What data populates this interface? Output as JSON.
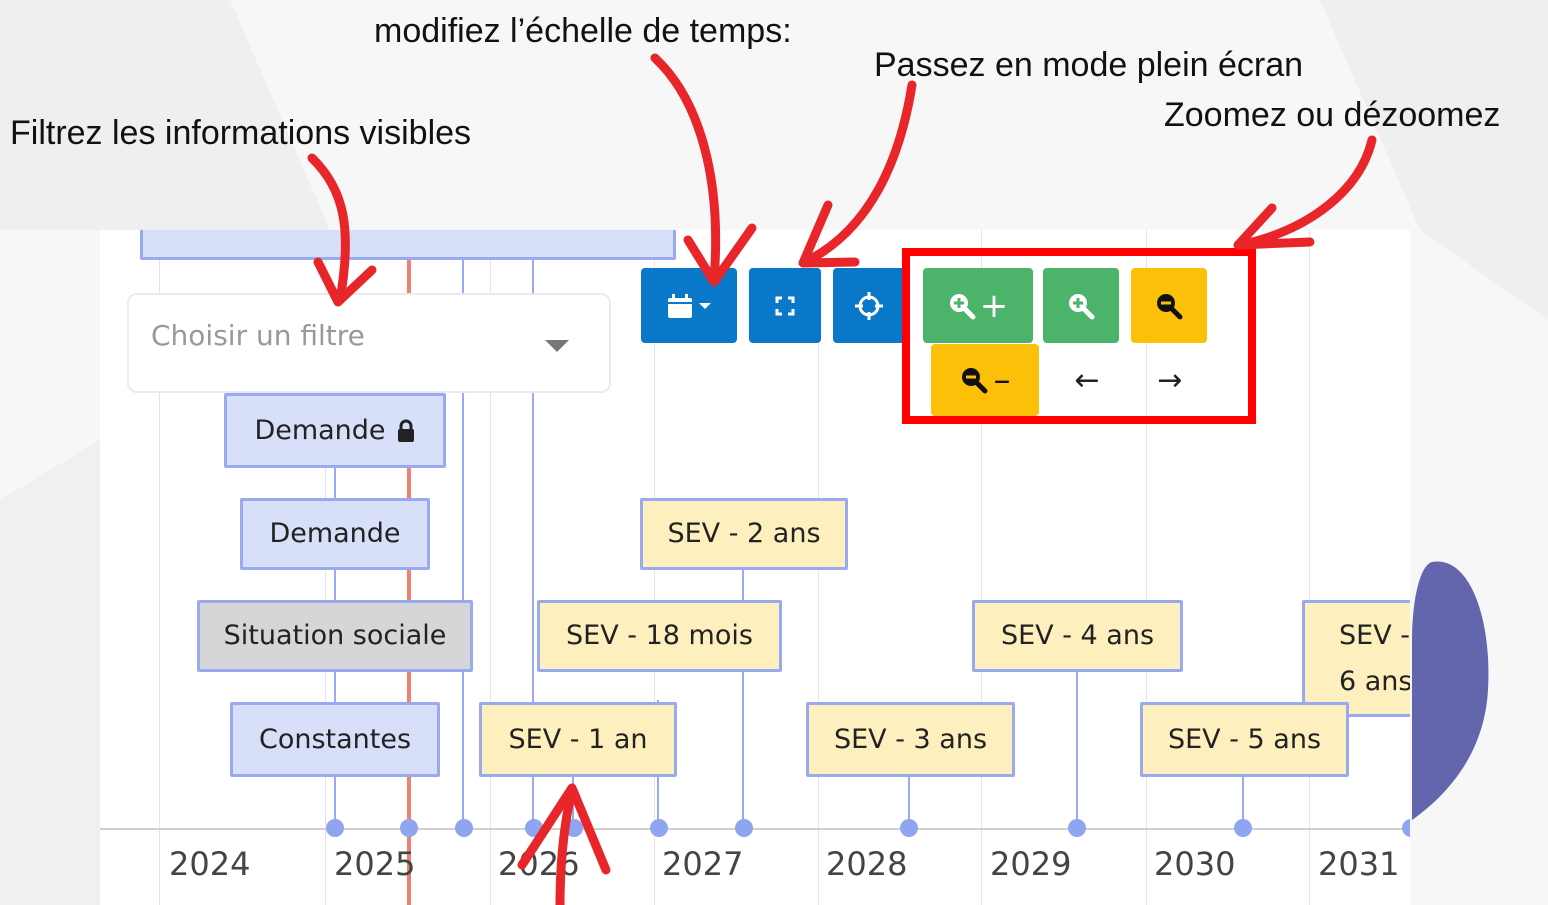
{
  "annotations": {
    "time_scale": "modifiez l’échelle de temps:",
    "fullscreen": "Passez en mode plein écran",
    "zoom": "Zoomez ou dézoomez",
    "filter": "Filtrez les informations visibles"
  },
  "filter": {
    "placeholder": "Choisir un filtre"
  },
  "toolbar": {
    "zoom_in_plus_label": "+",
    "zoom_out_minus_label": "–",
    "prev_arrow": "←",
    "next_arrow": "→"
  },
  "timeline": {
    "years": [
      "2024",
      "2025",
      "2026",
      "2027",
      "2028",
      "2029",
      "2030",
      "2031"
    ],
    "rows": {
      "demande_locked": "Demande",
      "demande": "Demande",
      "situation_sociale": "Situation sociale",
      "constantes": "Constantes"
    },
    "sev": {
      "two_years": "SEV - 2 ans",
      "eighteen_months": "SEV - 18 mois",
      "four_years": "SEV - 4 ans",
      "six_years_line1": "SEV -",
      "six_years_line2": "6 ans",
      "one_year": "SEV - 1 an",
      "three_years": "SEV - 3 ans",
      "five_years": "SEV - 5 ans"
    }
  },
  "colors": {
    "highlight_box": "#ff0000",
    "arrow": "#e8262a",
    "today_line": "#f08070",
    "button_blue": "#0a78c8",
    "button_green": "#4cb36a",
    "button_yellow": "#fdc008"
  }
}
